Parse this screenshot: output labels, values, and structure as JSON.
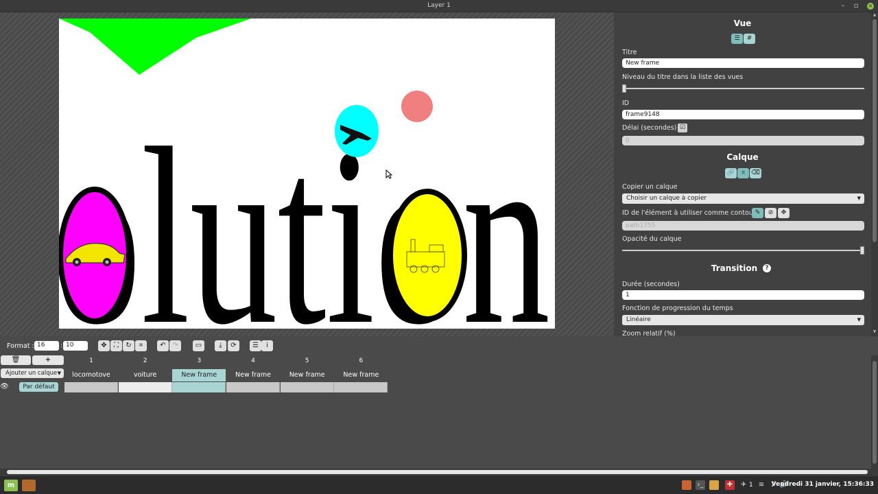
{
  "window": {
    "title": "Layer 1"
  },
  "panel": {
    "vue_heading": "Vue",
    "titre_label": "Titre",
    "titre_value": "New frame",
    "niveau_label": "Niveau du titre dans la liste des vues",
    "niveau_level": 0.0,
    "id_label": "ID",
    "id_value": "frame9148",
    "delai_label": "Délai (secondes)",
    "delai_value": "0",
    "calque_heading": "Calque",
    "copier_label": "Copier un calque",
    "copier_select": "Choisir un calque à copier",
    "contour_label": "ID de l'élément à utiliser comme contour",
    "contour_placeholder": "path1755",
    "opacite_label": "Opacité du calque",
    "opacite_level": 1.0,
    "transition_heading": "Transition",
    "duree_label": "Durée (secondes)",
    "duree_value": "1",
    "fonction_label": "Fonction de progression du temps",
    "fonction_select": "Linéaire",
    "zoom_label": "Zoom relatif (%)"
  },
  "canvas": {
    "text": "olution"
  },
  "toolbar": {
    "format_label": "Format :",
    "format_w": "16",
    "format_sep": ":",
    "format_h": "10"
  },
  "timeline": {
    "add_layer": "Ajouter un calque",
    "layer_name": "Par défaut",
    "frames": [
      {
        "num": "1",
        "title": "locomotove"
      },
      {
        "num": "2",
        "title": "voiture"
      },
      {
        "num": "3",
        "title": "New frame"
      },
      {
        "num": "4",
        "title": "New frame"
      },
      {
        "num": "5",
        "title": "New frame"
      },
      {
        "num": "6",
        "title": "New frame"
      }
    ],
    "current_frame": 3
  },
  "taskbar": {
    "clock": "Vendredi 31 janvier, 15:36:33",
    "tray_count": "1"
  },
  "colors": {
    "accent": "#a8d5d3",
    "panel_bg": "#414141",
    "green_shape": "#00ff00",
    "magenta": "#ff00ff",
    "cyan": "#00ffff",
    "yellow": "#ffff00",
    "salmon": "#f08080"
  }
}
